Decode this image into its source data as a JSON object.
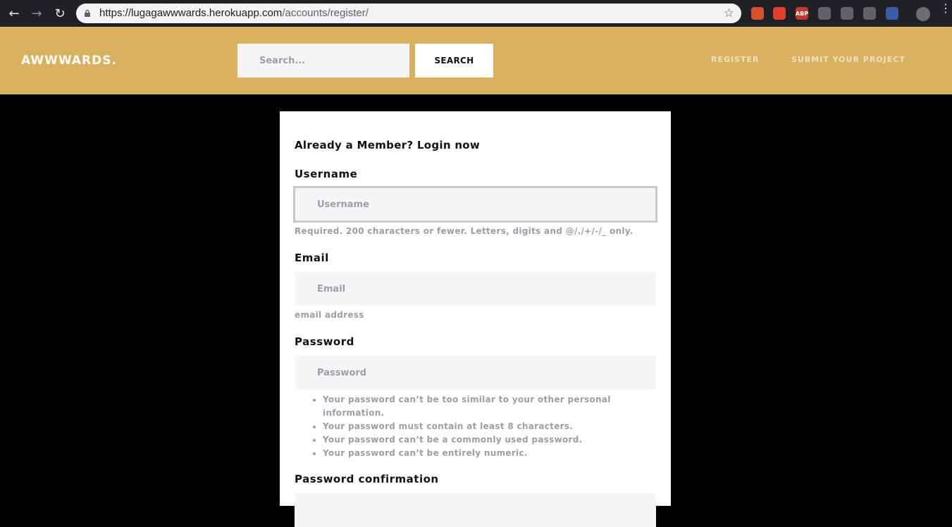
{
  "browser": {
    "url_host": "https://lugagawwwards.herokuapp.com",
    "url_path": "/accounts/register/",
    "extensions": [
      {
        "name": "ublock-icon",
        "color": "#d9502f",
        "label": ""
      },
      {
        "name": "video-icon",
        "color": "#e2402f",
        "label": ""
      },
      {
        "name": "abp-icon",
        "color": "#c2382d",
        "label": "ABP"
      },
      {
        "name": "puzzle-icon",
        "color": "#5f6368",
        "label": ""
      },
      {
        "name": "grammar-icon",
        "color": "#5f6368",
        "label": ""
      },
      {
        "name": "camera-icon",
        "color": "#5f6368",
        "label": ""
      },
      {
        "name": "flag-icon",
        "color": "#3c5aa8",
        "label": ""
      }
    ]
  },
  "header": {
    "brand": "AWWWARDS.",
    "search_placeholder": "Search...",
    "search_button": "SEARCH",
    "links": [
      "REGISTER",
      "SUBMIT YOUR PROJECT"
    ]
  },
  "form": {
    "heading": "Already a Member? Login now",
    "username_label": "Username",
    "username_placeholder": "Username",
    "username_help": "Required. 200 characters or fewer. Letters, digits and @/./+/-/_ only.",
    "email_label": "Email",
    "email_placeholder": "Email",
    "email_help": "email address",
    "password_label": "Password",
    "password_placeholder": "Password",
    "password_rules": [
      "Your password can’t be too similar to your other personal information.",
      "Your password must contain at least 8 characters.",
      "Your password can’t be a commonly used password.",
      "Your password can’t be entirely numeric."
    ],
    "password_confirm_label": "Password confirmation"
  },
  "colors": {
    "header_bg": "#d9b15f",
    "page_bg": "#000000",
    "card_bg": "#ffffff",
    "input_bg": "#f5f5f7"
  }
}
